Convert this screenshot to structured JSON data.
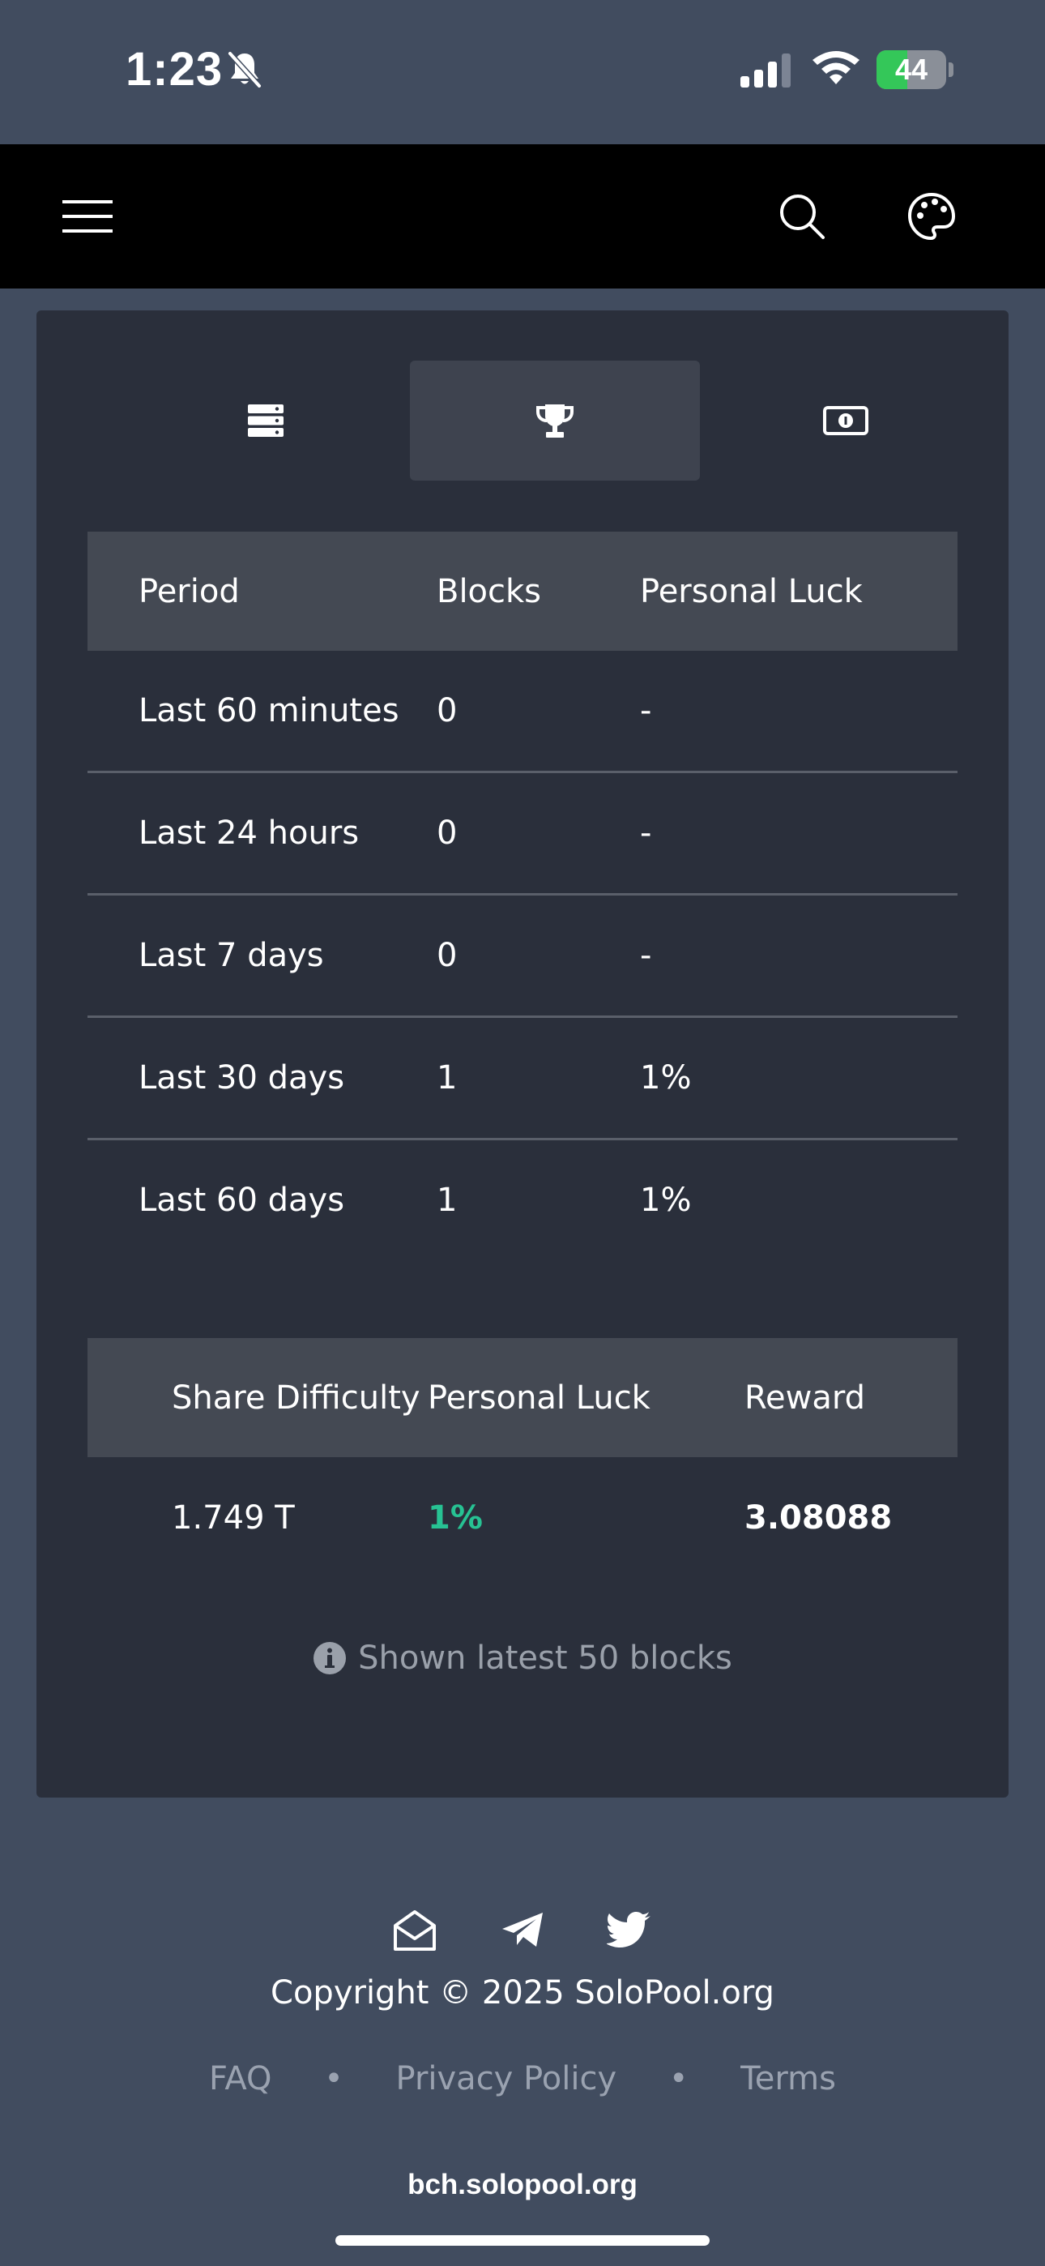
{
  "status_bar": {
    "time": "1:23",
    "battery_level": "44",
    "battery_fraction": 0.44,
    "icons": [
      "bell-slash-icon",
      "cellular-signal-icon",
      "wifi-icon",
      "battery-charging-icon"
    ]
  },
  "navbar": {
    "icons": [
      "hamburger-menu-icon",
      "search-icon",
      "palette-icon"
    ]
  },
  "tabs": [
    {
      "icon": "server-icon",
      "active": false
    },
    {
      "icon": "trophy-icon",
      "active": true
    },
    {
      "icon": "money-bill-icon",
      "active": false
    }
  ],
  "blocks_table": {
    "headers": [
      "Period",
      "Blocks",
      "Personal Luck"
    ],
    "rows": [
      {
        "period": "Last 60 minutes",
        "blocks": "0",
        "luck": "-"
      },
      {
        "period": "Last 24 hours",
        "blocks": "0",
        "luck": "-"
      },
      {
        "period": "Last 7 days",
        "blocks": "0",
        "luck": "-"
      },
      {
        "period": "Last 30 days",
        "blocks": "1",
        "luck": "1%"
      },
      {
        "period": "Last 60 days",
        "blocks": "1",
        "luck": "1%"
      }
    ]
  },
  "shares_table": {
    "headers": [
      "Share Difficulty",
      "Personal Luck",
      "Reward"
    ],
    "rows": [
      {
        "difficulty": "1.749 T",
        "luck": "1%",
        "reward": "3.08088"
      }
    ],
    "luck_color": "#27c293"
  },
  "info_note": "Shown latest 50 blocks",
  "footer": {
    "icons": [
      "envelope-open-icon",
      "telegram-icon",
      "twitter-icon"
    ],
    "copyright": "Copyright © 2025 SoloPool.org",
    "links": [
      "FAQ",
      "Privacy Policy",
      "Terms"
    ],
    "separator": "•"
  },
  "browser": {
    "url": "bch.solopool.org"
  },
  "colors": {
    "background": "#414c5f",
    "card": "#2a2f3b",
    "navbar": "#000000",
    "table_header": "#444953",
    "accent_green": "#27c293"
  }
}
